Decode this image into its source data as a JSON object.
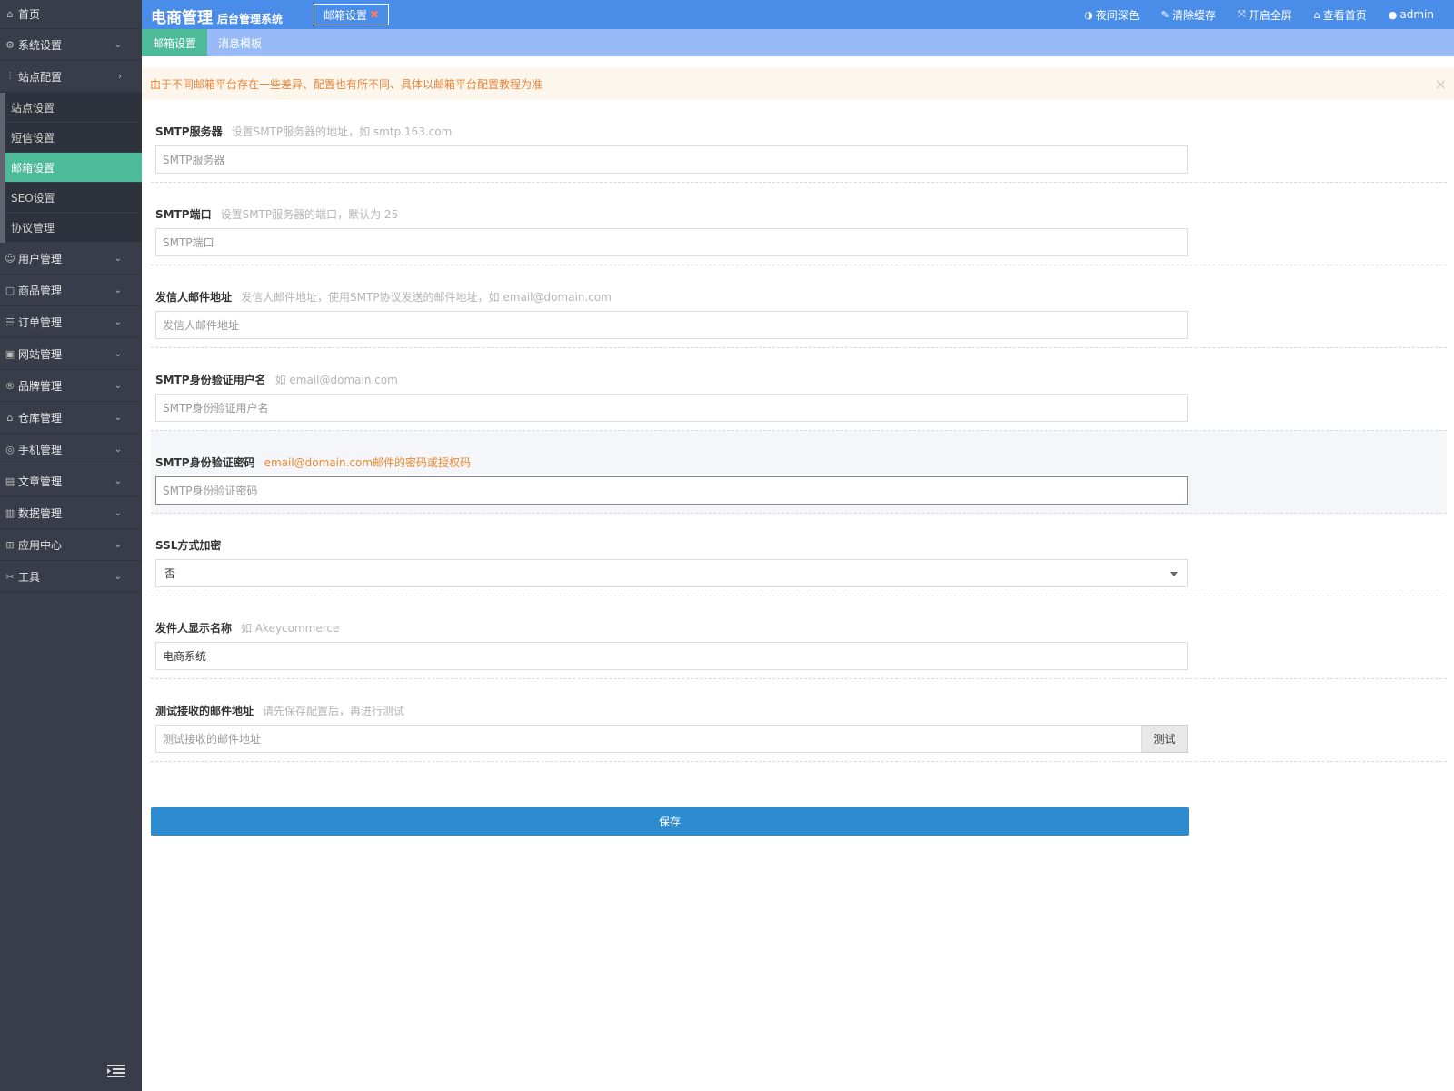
{
  "sidebar": {
    "home": {
      "label": "首页",
      "icon": "home-icon"
    },
    "menus": [
      {
        "label": "系统设置",
        "icon": "gear-icon"
      },
      {
        "label": "站点配置",
        "icon": "sliders-icon"
      }
    ],
    "site_config_items": [
      {
        "label": "站点设置"
      },
      {
        "label": "短信设置"
      },
      {
        "label": "邮箱设置"
      },
      {
        "label": "SEO设置"
      },
      {
        "label": "协议管理"
      }
    ],
    "menus_after": [
      {
        "label": "用户管理",
        "icon": "user-icon"
      },
      {
        "label": "商品管理",
        "icon": "bag-icon"
      },
      {
        "label": "订单管理",
        "icon": "order-icon"
      },
      {
        "label": "网站管理",
        "icon": "website-icon"
      },
      {
        "label": "品牌管理",
        "icon": "brand-icon"
      },
      {
        "label": "仓库管理",
        "icon": "warehouse-icon"
      },
      {
        "label": "手机管理",
        "icon": "mobile-icon"
      },
      {
        "label": "文章管理",
        "icon": "article-icon"
      },
      {
        "label": "数据管理",
        "icon": "database-icon"
      },
      {
        "label": "应用中心",
        "icon": "apps-icon"
      },
      {
        "label": "工具",
        "icon": "tools-icon"
      }
    ]
  },
  "header": {
    "brand_main": "电商管理",
    "brand_sub": "后台管理系统",
    "open_tab": "邮箱设置",
    "actions": [
      {
        "label": "夜间深色",
        "icon": "contrast-icon"
      },
      {
        "label": "清除缓存",
        "icon": "brush-icon"
      },
      {
        "label": "开启全屏",
        "icon": "fullscreen-icon"
      },
      {
        "label": "查看首页",
        "icon": "home-icon"
      },
      {
        "label": "admin",
        "icon": "user-icon"
      }
    ]
  },
  "tabs": [
    {
      "label": "邮箱设置"
    },
    {
      "label": "消息模板"
    }
  ],
  "alert": "由于不同邮箱平台存在一些差异、配置也有所不同、具体以邮箱平台配置教程为准",
  "form": {
    "smtp_server": {
      "label": "SMTP服务器",
      "hint": "设置SMTP服务器的地址，如 smtp.163.com",
      "placeholder": "SMTP服务器",
      "value": ""
    },
    "smtp_port": {
      "label": "SMTP端口",
      "hint": "设置SMTP服务器的端口，默认为 25",
      "placeholder": "SMTP端口",
      "value": ""
    },
    "sender_email": {
      "label": "发信人邮件地址",
      "hint": "发信人邮件地址，使用SMTP协议发送的邮件地址，如 email@domain.com",
      "placeholder": "发信人邮件地址",
      "value": ""
    },
    "auth_user": {
      "label": "SMTP身份验证用户名",
      "hint": "如 email@domain.com",
      "placeholder": "SMTP身份验证用户名",
      "value": ""
    },
    "auth_pass": {
      "label": "SMTP身份验证密码",
      "hint": "email@domain.com邮件的密码或授权码",
      "placeholder": "SMTP身份验证密码",
      "value": ""
    },
    "ssl": {
      "label": "SSL方式加密",
      "value": "否"
    },
    "sender_name": {
      "label": "发件人显示名称",
      "hint": "如 Akeycommerce",
      "placeholder": "",
      "value": "电商系统"
    },
    "test_email": {
      "label": "测试接收的邮件地址",
      "hint": "请先保存配置后，再进行测试",
      "placeholder": "测试接收的邮件地址",
      "value": "",
      "button": "测试"
    }
  },
  "save_label": "保存",
  "colors": {
    "sidebar_bg": "#393d49",
    "header_bg": "#4a8de9",
    "tabbar_bg": "#98baf7",
    "active_green": "#4dbb98",
    "alert_bg": "#fdf6ec",
    "alert_text": "#e6843a",
    "save_btn": "#2d8cd0"
  }
}
